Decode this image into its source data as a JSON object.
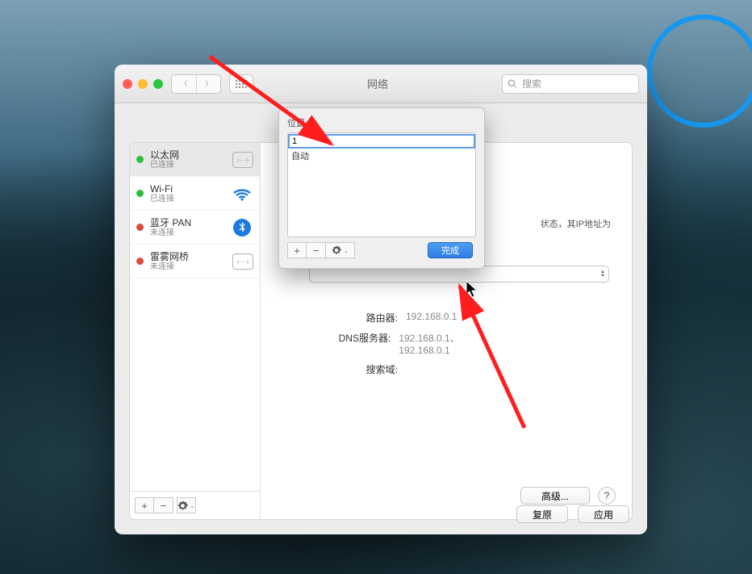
{
  "window": {
    "title": "网络",
    "search_placeholder": "搜索"
  },
  "sidebar": {
    "items": [
      {
        "name": "以太网",
        "status": "已连接",
        "state": "green",
        "icon": "ethernet",
        "selected": true
      },
      {
        "name": "Wi-Fi",
        "status": "已连接",
        "state": "green",
        "icon": "wifi"
      },
      {
        "name": "蓝牙 PAN",
        "status": "未连接",
        "state": "red",
        "icon": "bluetooth"
      },
      {
        "name": "雷雾网桥",
        "status": "未连接",
        "state": "red",
        "icon": "ethernet"
      }
    ]
  },
  "main": {
    "loc_chip": "位",
    "hint_right": "状态，其IP地址为",
    "router_label": "路由器:",
    "router_value": "192.168.0.1",
    "dns_label": "DNS服务器:",
    "dns_value": "192.168.0.1、192.168.0.1",
    "search_domain_label": "搜索域:",
    "advanced": "高级...",
    "restore": "复原",
    "apply": "应用"
  },
  "dialog": {
    "label": "位置",
    "input_value": "1",
    "option_auto": "自动",
    "done": "完成"
  }
}
